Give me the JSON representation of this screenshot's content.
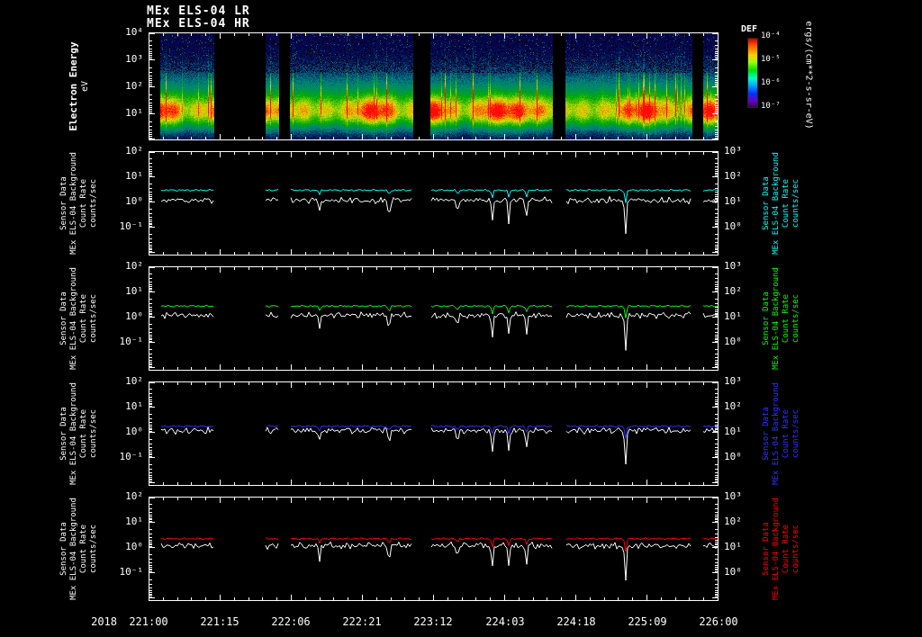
{
  "titles": {
    "line1": "MEx ELS-04 LR",
    "line2": "MEx ELS-04 HR"
  },
  "chart_data": {
    "type": [
      "heatmap",
      "line"
    ],
    "xaxis": {
      "year_label": "2018",
      "tick_labels": [
        "221:00",
        "221:15",
        "222:06",
        "222:21",
        "223:12",
        "224:03",
        "224:18",
        "225:09",
        "226:00"
      ],
      "tick_format": "day-of-year:hour",
      "note": "9 major ticks evenly spaced, 15 hours apart, day 221 hour 00 to day 226 hour 00 of 2018"
    },
    "data_gaps_frac": [
      [
        0.0,
        0.02
      ],
      [
        0.114,
        0.205
      ],
      [
        0.229,
        0.248
      ],
      [
        0.463,
        0.493
      ],
      [
        0.708,
        0.73
      ],
      [
        0.953,
        0.972
      ]
    ],
    "spectrogram": {
      "type": "heatmap",
      "ylabel_lines": [
        "Electron Energy",
        "eV"
      ],
      "yaxis_tick_labels": [
        "10⁴",
        "10³",
        "10²",
        "10¹"
      ],
      "ylim_log10_ev": [
        0,
        4
      ],
      "peak_flux_band_center_ev": 10,
      "peak_band_color": "yellow-green",
      "high_energy_background": "dark blue to purple speckle",
      "colorbar": {
        "title": "DEF",
        "tick_labels": [
          "10⁻⁴",
          "10⁻⁵",
          "10⁻⁶",
          "10⁻⁷"
        ],
        "unit_label": "ergs/(cm**2-s-sr-eV)",
        "colormap": "rainbow, red high to purple low"
      }
    },
    "dips": {
      "time_frac": [
        0.3,
        0.422,
        0.542,
        0.603,
        0.632,
        0.663,
        0.837
      ],
      "depth_decades": [
        0.5,
        0.6,
        0.5,
        0.9,
        0.8,
        0.7,
        1.4
      ]
    },
    "line_panels": [
      {
        "color": "#00ffff",
        "left_axis_tick_labels": [
          "10²",
          "10¹",
          "10⁰",
          "10⁻¹"
        ],
        "right_axis_tick_labels": [
          "10³",
          "10²",
          "10¹",
          "10⁰"
        ],
        "left_label_lines": [
          "Sensor Data",
          "MEx ELS-04 Background",
          "Count Rate",
          "counts/sec"
        ],
        "right_label_lines": [
          "Sensor Data",
          "MEx ELS-04 Background",
          "Count Rate",
          "counts/sec"
        ],
        "white_series": {
          "name": "background count rate",
          "baseline_log10": 0.05,
          "noise_log10": 0.1
        },
        "colored_series": {
          "name": "smoothed background count rate",
          "baseline_log10": 0.45,
          "noise_log10": 0.05
        }
      },
      {
        "color": "#00ff00",
        "left_axis_tick_labels": [
          "10²",
          "10¹",
          "10⁰",
          "10⁻¹"
        ],
        "right_axis_tick_labels": [
          "10³",
          "10²",
          "10¹",
          "10⁰"
        ],
        "left_label_lines": [
          "Sensor Data",
          "MEx ELS-04 Background",
          "Count Rate",
          "counts/sec"
        ],
        "right_label_lines": [
          "Sensor Data",
          "MEx ELS-04 Background",
          "Count Rate",
          "counts/sec"
        ],
        "white_series": {
          "name": "background count rate",
          "baseline_log10": 0.05,
          "noise_log10": 0.1
        },
        "colored_series": {
          "name": "smoothed background count rate",
          "baseline_log10": 0.42,
          "noise_log10": 0.05
        }
      },
      {
        "color": "#3333ff",
        "left_axis_tick_labels": [
          "10²",
          "10¹",
          "10⁰",
          "10⁻¹"
        ],
        "right_axis_tick_labels": [
          "10³",
          "10²",
          "10¹",
          "10⁰"
        ],
        "left_label_lines": [
          "Sensor Data",
          "MEx ELS-04 Background",
          "Count Rate",
          "counts/sec"
        ],
        "right_label_lines": [
          "Sensor Data",
          "MEx ELS-04 Background",
          "Count Rate",
          "counts/sec"
        ],
        "white_series": {
          "name": "background count rate",
          "baseline_log10": 0.05,
          "noise_log10": 0.1
        },
        "colored_series": {
          "name": "smoothed background count rate",
          "baseline_log10": 0.22,
          "noise_log10": 0.05
        }
      },
      {
        "color": "#ff0000",
        "left_axis_tick_labels": [
          "10²",
          "10¹",
          "10⁰",
          "10⁻¹"
        ],
        "right_axis_tick_labels": [
          "10³",
          "10²",
          "10¹",
          "10⁰"
        ],
        "left_label_lines": [
          "Sensor Data",
          "MEx ELS-04 Background",
          "Count Rate",
          "counts/sec"
        ],
        "right_label_lines": [
          "Sensor Data",
          "MEx ELS-04 Background",
          "Count Rate",
          "counts/sec"
        ],
        "white_series": {
          "name": "background count rate",
          "baseline_log10": 0.05,
          "noise_log10": 0.1
        },
        "colored_series": {
          "name": "smoothed background count rate",
          "baseline_log10": 0.33,
          "noise_log10": 0.05
        }
      }
    ]
  }
}
